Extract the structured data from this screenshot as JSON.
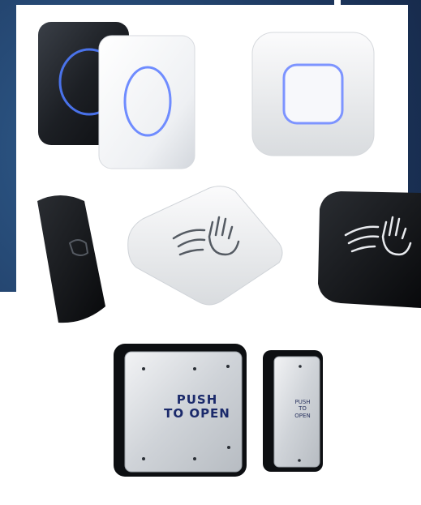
{
  "photo": {
    "background": {
      "blue_panel": "#1f3b63",
      "white_panel": "#ffffff"
    },
    "products": [
      {
        "name": "touchless exit button black with blue ring"
      },
      {
        "name": "touchless exit button white with blue ring"
      },
      {
        "name": "square white exit button with blue led"
      },
      {
        "name": "narrow black hand wave sensor"
      },
      {
        "name": "white hand wave exit button"
      },
      {
        "name": "black hand wave exit button"
      },
      {
        "name": "stainless push to open plate"
      },
      {
        "name": "narrow stainless push to open plate"
      }
    ],
    "labels": {
      "large_plate_line1": "PUSH",
      "large_plate_line2": "TO OPEN",
      "small_plate_line1": "PUSH",
      "small_plate_line2": "TO",
      "small_plate_line3": "OPEN"
    }
  }
}
